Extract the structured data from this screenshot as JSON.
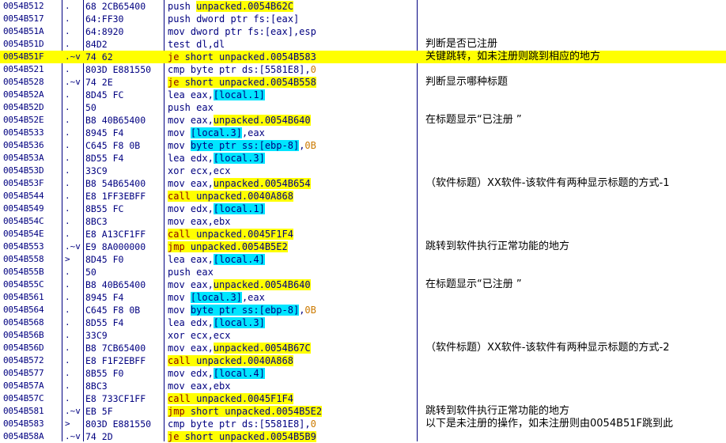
{
  "rows": [
    {
      "addr": "0054B512",
      "gut": ".",
      "hex": "68 2CB65400",
      "cmd": [
        [
          "op",
          "push "
        ],
        [
          "addrhl",
          "unpacked.0054B62C"
        ]
      ],
      "cmt": ""
    },
    {
      "addr": "0054B517",
      "gut": ".",
      "hex": "64:FF30",
      "cmd": [
        [
          "op",
          "push dword ptr fs:[eax]"
        ]
      ],
      "cmt": ""
    },
    {
      "addr": "0054B51A",
      "gut": ".",
      "hex": "64:8920",
      "cmd": [
        [
          "op",
          "mov dword ptr fs:[eax],esp"
        ]
      ],
      "cmt": ""
    },
    {
      "addr": "0054B51D",
      "gut": ".",
      "hex": "84D2",
      "cmd": [
        [
          "op",
          "test dl,dl"
        ]
      ],
      "cmt": "判断是否已注册"
    },
    {
      "addr": "0054B51F",
      "gut": ".~v",
      "hex": "74 62",
      "cmd": [
        [
          "jump",
          "je"
        ],
        [
          "op",
          " short unpacked.0054B583"
        ]
      ],
      "cmt": "关键跳转，如未注册则跳到相应的地方",
      "selected": true
    },
    {
      "addr": "0054B521",
      "gut": ".",
      "hex": "803D E881550",
      "cmd": [
        [
          "op",
          "cmp byte ptr ds:[5581E8],"
        ],
        [
          "num",
          "0"
        ]
      ],
      "cmt": ""
    },
    {
      "addr": "0054B528",
      "gut": ".~v",
      "hex": "74 2E",
      "cmd": [
        [
          "jump",
          "je"
        ],
        [
          "addrhl",
          " short unpacked.0054B558"
        ]
      ],
      "cmt": "判断显示哪种标题"
    },
    {
      "addr": "0054B52A",
      "gut": ".",
      "hex": "8D45 FC",
      "cmd": [
        [
          "op",
          "lea eax,"
        ],
        [
          "loc",
          "[local.1]"
        ]
      ],
      "cmt": ""
    },
    {
      "addr": "0054B52D",
      "gut": ".",
      "hex": "50",
      "cmd": [
        [
          "op",
          "push eax"
        ]
      ],
      "cmt": ""
    },
    {
      "addr": "0054B52E",
      "gut": ".",
      "hex": "B8 40B65400",
      "cmd": [
        [
          "op",
          "mov eax,"
        ],
        [
          "addrhl",
          "unpacked.0054B640"
        ]
      ],
      "cmt": "在标题显示“已注册 ”"
    },
    {
      "addr": "0054B533",
      "gut": ".",
      "hex": "8945 F4",
      "cmd": [
        [
          "op",
          "mov "
        ],
        [
          "loc",
          "[local.3]"
        ],
        [
          "op",
          ",eax"
        ]
      ],
      "cmt": ""
    },
    {
      "addr": "0054B536",
      "gut": ".",
      "hex": "C645 F8 0B",
      "cmd": [
        [
          "op",
          "mov "
        ],
        [
          "loc",
          "byte ptr ss:[ebp-8]"
        ],
        [
          "op",
          ","
        ],
        [
          "num",
          "0B"
        ]
      ],
      "cmt": ""
    },
    {
      "addr": "0054B53A",
      "gut": ".",
      "hex": "8D55 F4",
      "cmd": [
        [
          "op",
          "lea edx,"
        ],
        [
          "loc",
          "[local.3]"
        ]
      ],
      "cmt": ""
    },
    {
      "addr": "0054B53D",
      "gut": ".",
      "hex": "33C9",
      "cmd": [
        [
          "op",
          "xor ecx,ecx"
        ]
      ],
      "cmt": ""
    },
    {
      "addr": "0054B53F",
      "gut": ".",
      "hex": "B8 54B65400",
      "cmd": [
        [
          "op",
          "mov eax,"
        ],
        [
          "addrhl",
          "unpacked.0054B654"
        ]
      ],
      "cmt": "（软件标题）XX软件-该软件有两种显示标题的方式-1"
    },
    {
      "addr": "0054B544",
      "gut": ".",
      "hex": "E8 1FF3EBFF",
      "cmd": [
        [
          "callop",
          "call"
        ],
        [
          "addrhl",
          " unpacked.0040A868"
        ]
      ],
      "cmt": ""
    },
    {
      "addr": "0054B549",
      "gut": ".",
      "hex": "8B55 FC",
      "cmd": [
        [
          "op",
          "mov edx,"
        ],
        [
          "loc",
          "[local.1]"
        ]
      ],
      "cmt": ""
    },
    {
      "addr": "0054B54C",
      "gut": ".",
      "hex": "8BC3",
      "cmd": [
        [
          "op",
          "mov eax,ebx"
        ]
      ],
      "cmt": ""
    },
    {
      "addr": "0054B54E",
      "gut": ".",
      "hex": "E8 A13CF1FF",
      "cmd": [
        [
          "callop",
          "call"
        ],
        [
          "addrhl",
          " unpacked.0045F1F4"
        ]
      ],
      "cmt": ""
    },
    {
      "addr": "0054B553",
      "gut": ".~v",
      "hex": "E9 8A000000",
      "cmd": [
        [
          "callop",
          "jmp"
        ],
        [
          "addrhl",
          " unpacked.0054B5E2"
        ]
      ],
      "cmt": "跳转到软件执行正常功能的地方"
    },
    {
      "addr": "0054B558",
      "gut": ">",
      "hex": "8D45 F0",
      "cmd": [
        [
          "op",
          "lea eax,"
        ],
        [
          "loc",
          "[local.4]"
        ]
      ],
      "cmt": ""
    },
    {
      "addr": "0054B55B",
      "gut": ".",
      "hex": "50",
      "cmd": [
        [
          "op",
          "push eax"
        ]
      ],
      "cmt": ""
    },
    {
      "addr": "0054B55C",
      "gut": ".",
      "hex": "B8 40B65400",
      "cmd": [
        [
          "op",
          "mov eax,"
        ],
        [
          "addrhl",
          "unpacked.0054B640"
        ]
      ],
      "cmt": "在标题显示“已注册 ”"
    },
    {
      "addr": "0054B561",
      "gut": ".",
      "hex": "8945 F4",
      "cmd": [
        [
          "op",
          "mov "
        ],
        [
          "loc",
          "[local.3]"
        ],
        [
          "op",
          ",eax"
        ]
      ],
      "cmt": ""
    },
    {
      "addr": "0054B564",
      "gut": ".",
      "hex": "C645 F8 0B",
      "cmd": [
        [
          "op",
          "mov "
        ],
        [
          "loc",
          "byte ptr ss:[ebp-8]"
        ],
        [
          "op",
          ","
        ],
        [
          "num",
          "0B"
        ]
      ],
      "cmt": ""
    },
    {
      "addr": "0054B568",
      "gut": ".",
      "hex": "8D55 F4",
      "cmd": [
        [
          "op",
          "lea edx,"
        ],
        [
          "loc",
          "[local.3]"
        ]
      ],
      "cmt": ""
    },
    {
      "addr": "0054B56B",
      "gut": ".",
      "hex": "33C9",
      "cmd": [
        [
          "op",
          "xor ecx,ecx"
        ]
      ],
      "cmt": ""
    },
    {
      "addr": "0054B56D",
      "gut": ".",
      "hex": "B8 7CB65400",
      "cmd": [
        [
          "op",
          "mov eax,"
        ],
        [
          "addrhl",
          "unpacked.0054B67C"
        ]
      ],
      "cmt": "（软件标题）XX软件-该软件有两种显示标题的方式-2"
    },
    {
      "addr": "0054B572",
      "gut": ".",
      "hex": "E8 F1F2EBFF",
      "cmd": [
        [
          "callop",
          "call"
        ],
        [
          "addrhl",
          " unpacked.0040A868"
        ]
      ],
      "cmt": ""
    },
    {
      "addr": "0054B577",
      "gut": ".",
      "hex": "8B55 F0",
      "cmd": [
        [
          "op",
          "mov edx,"
        ],
        [
          "loc",
          "[local.4]"
        ]
      ],
      "cmt": ""
    },
    {
      "addr": "0054B57A",
      "gut": ".",
      "hex": "8BC3",
      "cmd": [
        [
          "op",
          "mov eax,ebx"
        ]
      ],
      "cmt": ""
    },
    {
      "addr": "0054B57C",
      "gut": ".",
      "hex": "E8 733CF1FF",
      "cmd": [
        [
          "callop",
          "call"
        ],
        [
          "addrhl",
          " unpacked.0045F1F4"
        ]
      ],
      "cmt": ""
    },
    {
      "addr": "0054B581",
      "gut": ".~v",
      "hex": "EB 5F",
      "cmd": [
        [
          "callop",
          "jmp"
        ],
        [
          "addrhl",
          " short unpacked.0054B5E2"
        ]
      ],
      "cmt": "跳转到软件执行正常功能的地方"
    },
    {
      "addr": "0054B583",
      "gut": ">",
      "hex": "803D E881550",
      "cmd": [
        [
          "op",
          "cmp byte ptr ds:[5581E8],"
        ],
        [
          "num",
          "0"
        ]
      ],
      "cmt": "以下是未注册的操作，如未注册则由0054B51F跳到此"
    },
    {
      "addr": "0054B58A",
      "gut": ".~v",
      "hex": "74 2D",
      "cmd": [
        [
          "jump",
          "je"
        ],
        [
          "addrhl",
          " short unpacked.0054B5B9"
        ]
      ],
      "cmt": ""
    }
  ]
}
